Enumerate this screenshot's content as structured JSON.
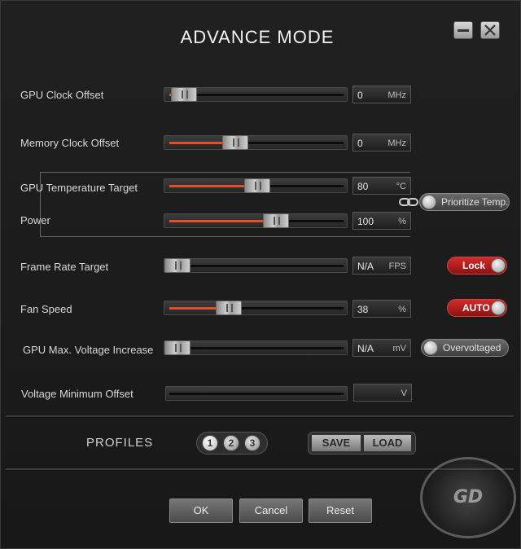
{
  "window": {
    "title": "ADVANCE MODE",
    "minimize_icon": "minimize-icon",
    "close_icon": "close-icon"
  },
  "settings": [
    {
      "label": "GPU Clock Offset",
      "value": "0",
      "unit": "MHz",
      "level": 0.04
    },
    {
      "label": "Memory Clock Offset",
      "value": "0",
      "unit": "MHz",
      "level": 0.37
    },
    {
      "label": "GPU Temperature Target",
      "value": "80",
      "unit": "°C",
      "level": 0.51
    },
    {
      "label": "Power",
      "value": "100",
      "unit": "%",
      "level": 0.63
    },
    {
      "label": "Frame Rate Target",
      "value": "N/A",
      "unit": "FPS",
      "level": 0.0
    },
    {
      "label": "Fan Speed",
      "value": "38",
      "unit": "%",
      "level": 0.33
    },
    {
      "label": "GPU Max. Voltage Increase",
      "value": "N/A",
      "unit": "mV",
      "level": 0.0
    },
    {
      "label": "Voltage Minimum Offset",
      "value": "",
      "unit": "V",
      "level": 0.0
    }
  ],
  "toggles": {
    "prioritize_temp": "Prioritize Temp.",
    "lock": "Lock",
    "auto": "AUTO",
    "overvoltaged": "Overvoltaged"
  },
  "colors": {
    "accent": "#e0502a",
    "toggle_red": "#c62020"
  },
  "profiles": {
    "label": "PROFILES",
    "numbers": [
      "1",
      "2",
      "3"
    ],
    "save": "SAVE",
    "load": "LOAD"
  },
  "buttons": {
    "ok": "OK",
    "cancel": "Cancel",
    "reset": "Reset"
  },
  "watermark": {
    "text": "GD",
    "icon": "watermark-logo"
  }
}
